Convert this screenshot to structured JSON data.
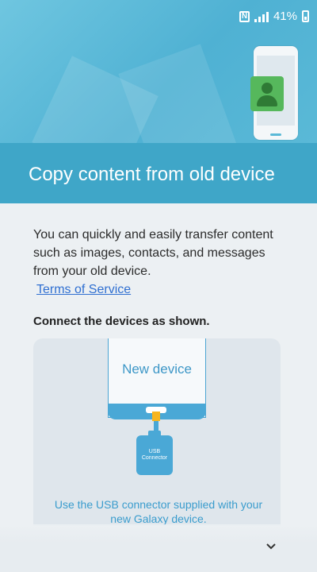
{
  "status_bar": {
    "nfc_label": "N",
    "battery_text": "41%"
  },
  "hero": {
    "title": "Copy content from old device"
  },
  "body": {
    "description": "You can quickly and easily transfer content such as images, contacts, and messages from your old device.",
    "terms_link": "Terms of Service",
    "connect_label": "Connect the devices as shown."
  },
  "diagram": {
    "device_label": "New device",
    "usb_label_line1": "USB",
    "usb_label_line2": "Connector",
    "note": "Use the USB connector supplied with your new Galaxy device."
  },
  "controls": {
    "scroll_icon": "chevron-down-icon",
    "scroll_glyph": "⌄"
  },
  "colors": {
    "accent_blue": "#3fa6c8",
    "link_blue": "#2f6fd1",
    "connector_yellow": "#f7b520"
  }
}
